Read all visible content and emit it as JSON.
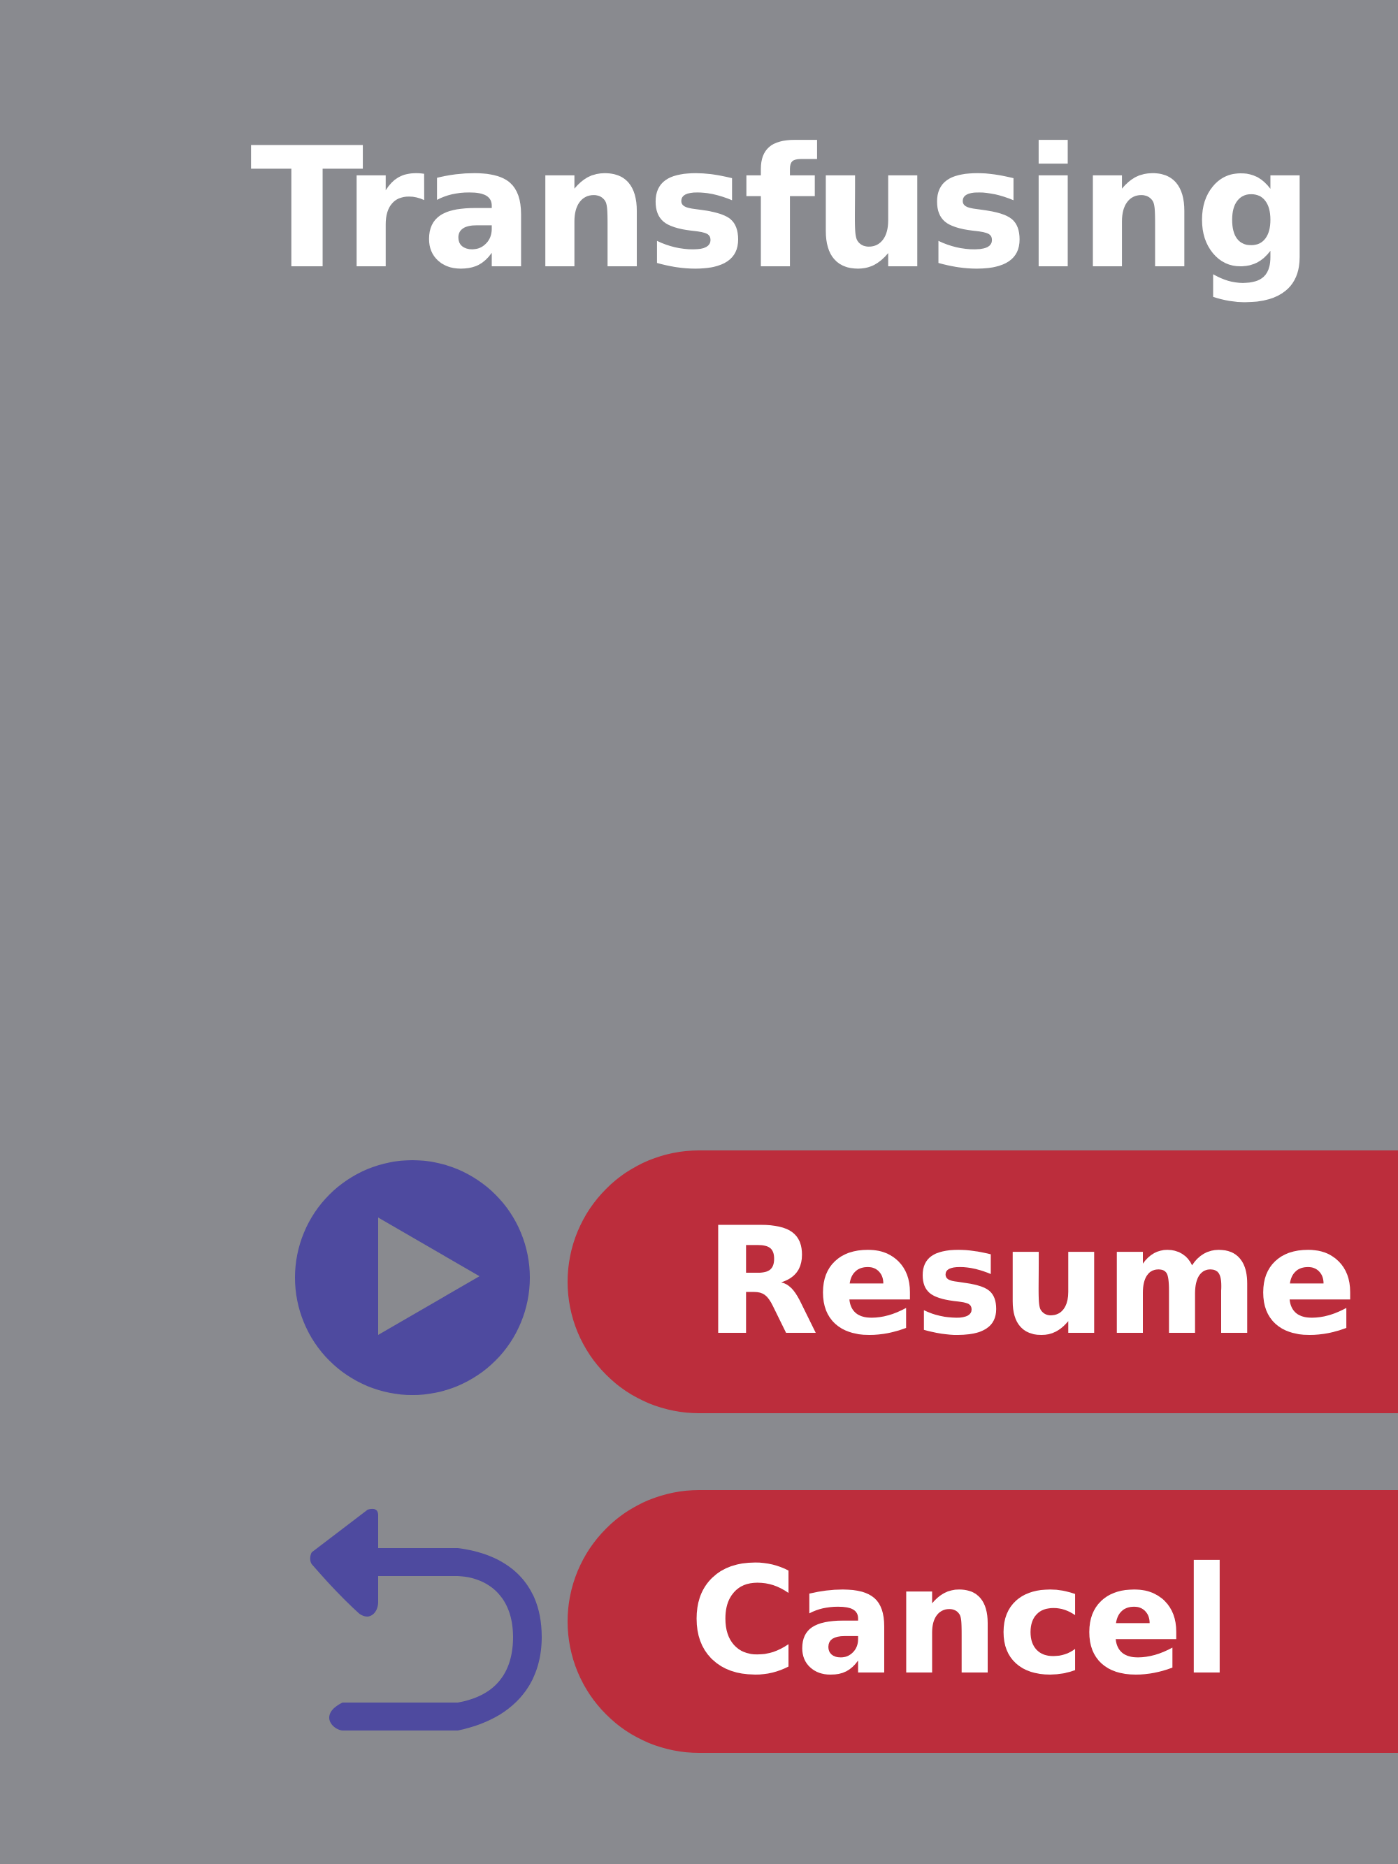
{
  "screen": {
    "title": "Transfusing"
  },
  "actions": {
    "resume_label": "Resume",
    "cancel_label": "Cancel"
  },
  "icons": {
    "resume": "play-icon",
    "cancel": "back-arrow-icon"
  },
  "colors": {
    "background": "#898A8F",
    "button": "#BC2D3C",
    "icon": "#4E4A9F",
    "text": "#FFFFFF"
  }
}
